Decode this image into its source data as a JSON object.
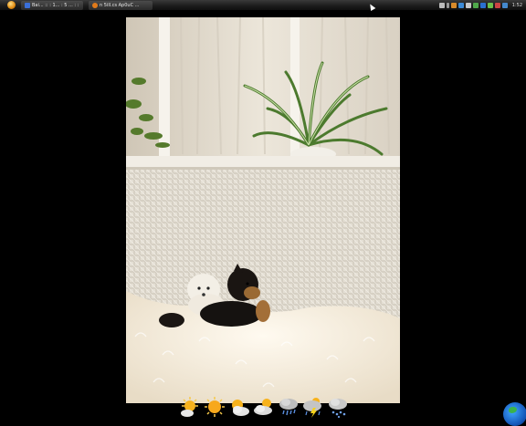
{
  "taskbar": {
    "start_icon": "windows-orb-icon",
    "tasks": [
      {
        "label": "Bai... :: : 1... : 5 ... : :",
        "icon": "browser-window-icon"
      },
      {
        "label": "n 5ill.cs Ap0uC ...",
        "icon": "firefox-icon"
      }
    ],
    "tray_icons": [
      "monitor-icon",
      "arrow-icon",
      "shield-icon",
      "network-icon",
      "speaker-icon",
      "app-icon",
      "app-icon",
      "battery-icon",
      "app-icon",
      "app-icon"
    ],
    "clock": "1:52"
  },
  "wallpaper": {
    "subject": "puppies-on-wicker-sofa",
    "colors": {
      "curtain": "#e9e2d6",
      "wicker": "#ded9cf",
      "fur": "#f3ece0",
      "plant": "#4c7a2e"
    }
  },
  "weather_icons": [
    "sun-cloud-icon",
    "sun-icon",
    "sun-cloud-icon",
    "partly-cloudy-icon",
    "cloud-rain-icon",
    "thunderstorm-icon",
    "cloud-snow-icon"
  ]
}
